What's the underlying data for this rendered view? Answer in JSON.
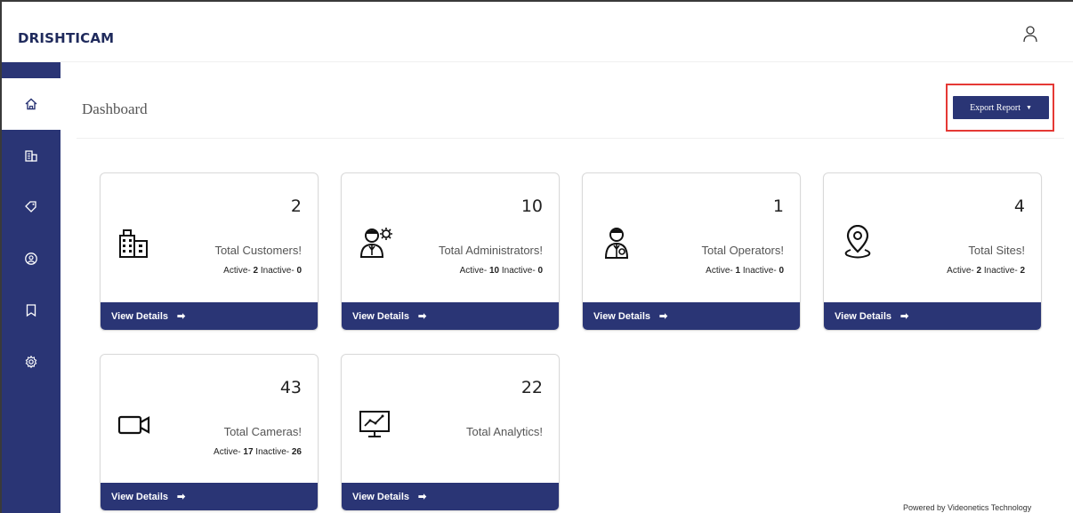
{
  "app": {
    "logo": "DRISHTICAM"
  },
  "header": {
    "user_icon": "user-icon"
  },
  "sidebar": {
    "items": [
      {
        "icon": "home-icon",
        "active": true
      },
      {
        "icon": "building-icon",
        "active": false
      },
      {
        "icon": "tag-icon",
        "active": false
      },
      {
        "icon": "user-circle-icon",
        "active": false
      },
      {
        "icon": "bookmark-icon",
        "active": false
      },
      {
        "icon": "settings-icon",
        "active": false
      }
    ]
  },
  "page": {
    "title": "Dashboard",
    "export_label": "Export Report",
    "export_caret": "▼"
  },
  "cards": [
    {
      "count": "2",
      "label": "Total Customers!",
      "active_prefix": "Active-",
      "active": "2",
      "inactive_prefix": "Inactive-",
      "inactive": "0",
      "footer": "View Details",
      "arrow": "➡",
      "icon": "buildings-icon"
    },
    {
      "count": "10",
      "label": "Total Administrators!",
      "active_prefix": "Active-",
      "active": "10",
      "inactive_prefix": "Inactive-",
      "inactive": "0",
      "footer": "View Details",
      "arrow": "➡",
      "icon": "admin-icon"
    },
    {
      "count": "1",
      "label": "Total Operators!",
      "active_prefix": "Active-",
      "active": "1",
      "inactive_prefix": "Inactive-",
      "inactive": "0",
      "footer": "View Details",
      "arrow": "➡",
      "icon": "operator-icon"
    },
    {
      "count": "4",
      "label": "Total Sites!",
      "active_prefix": "Active-",
      "active": "2",
      "inactive_prefix": "Inactive-",
      "inactive": "2",
      "footer": "View Details",
      "arrow": "➡",
      "icon": "location-pin-icon"
    },
    {
      "count": "43",
      "label": "Total Cameras!",
      "active_prefix": "Active-",
      "active": "17",
      "inactive_prefix": "Inactive-",
      "inactive": "26",
      "footer": "View Details",
      "arrow": "➡",
      "icon": "video-camera-icon"
    },
    {
      "count": "22",
      "label": "Total Analytics!",
      "footer": "View Details",
      "arrow": "➡",
      "icon": "analytics-monitor-icon"
    }
  ],
  "footer": {
    "powered_by": "Powered by Videonetics Technology"
  },
  "colors": {
    "primary": "#2a3575",
    "highlight": "#e53935"
  }
}
